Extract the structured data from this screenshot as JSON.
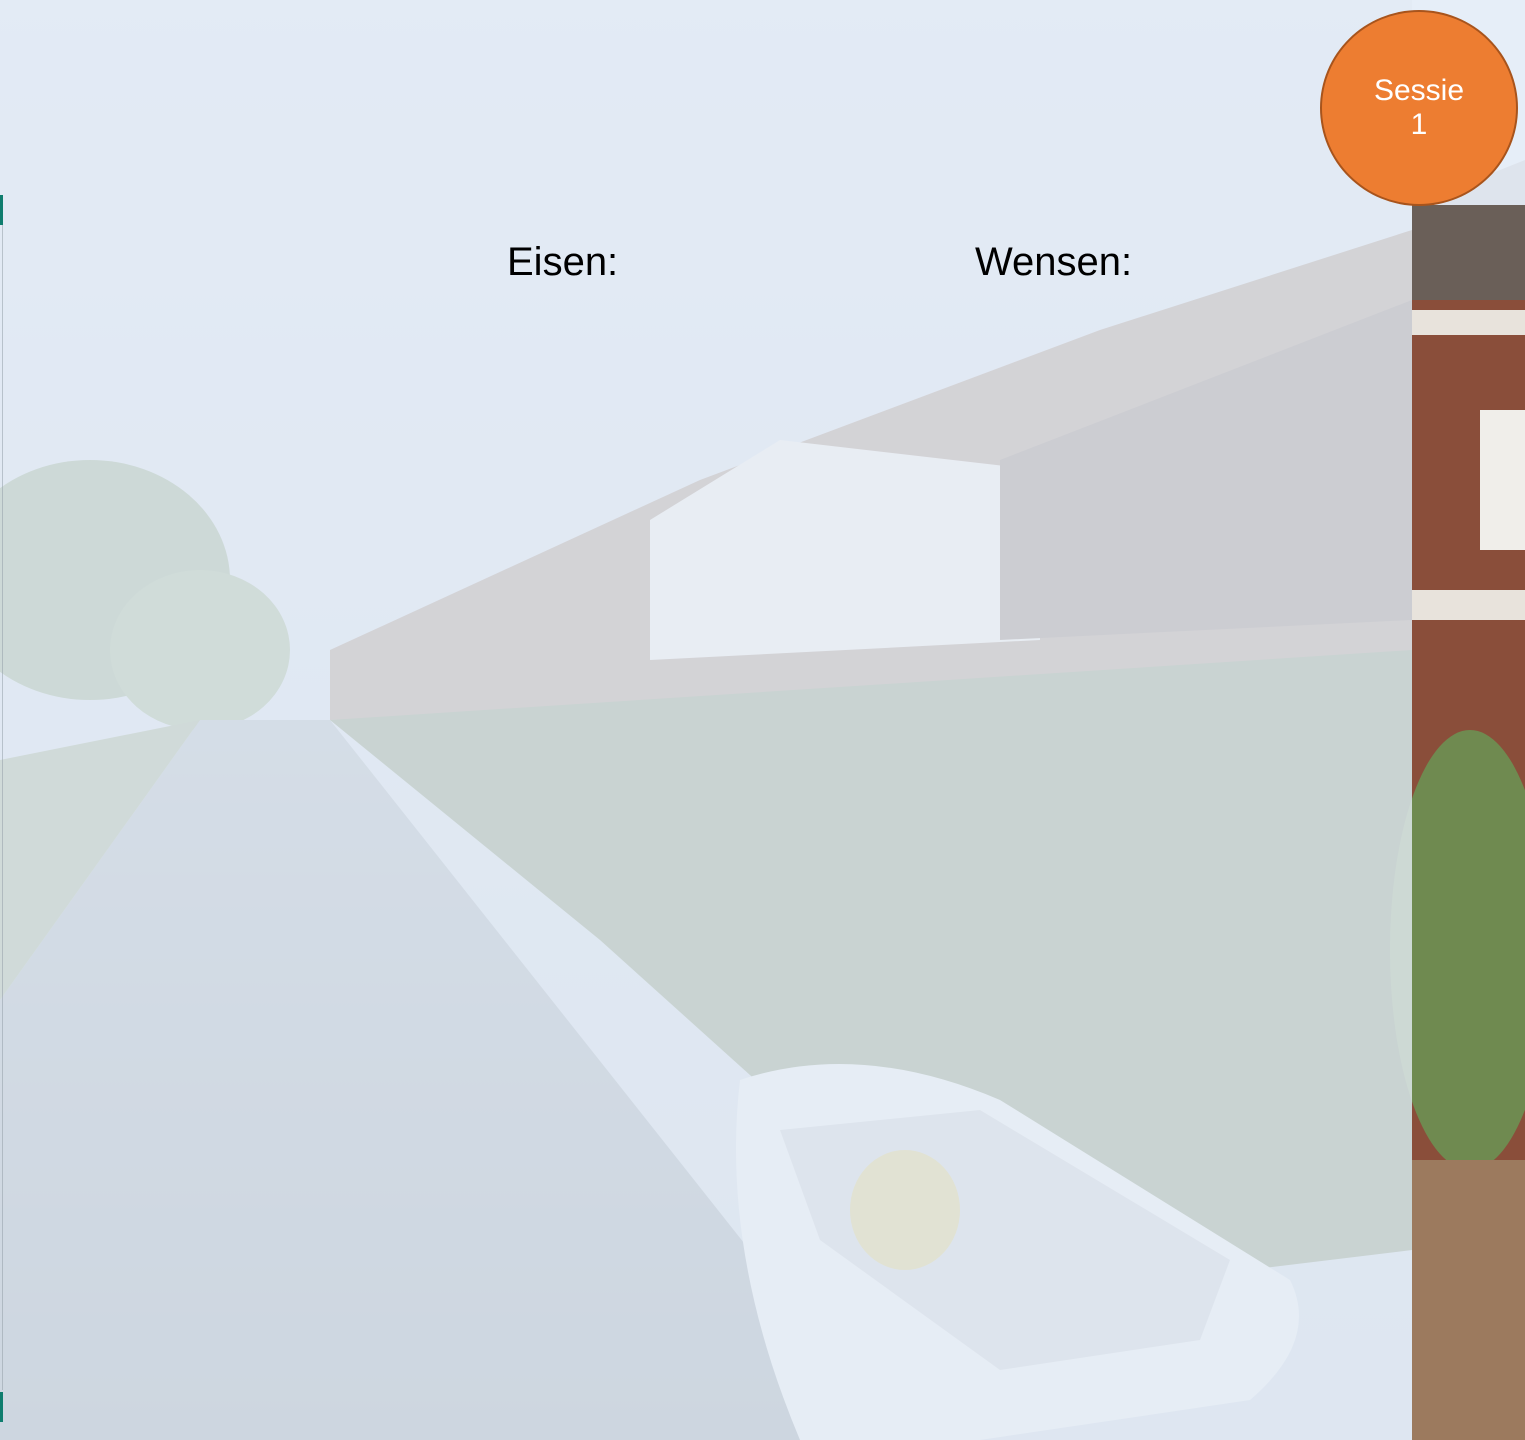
{
  "slide": {
    "heading_left": "Eisen:",
    "heading_right": "Wensen:"
  },
  "badge": {
    "line1": "Sessie",
    "line2": "1",
    "color": "#ed7d31"
  },
  "background": {
    "image": "canal-street-photo"
  }
}
